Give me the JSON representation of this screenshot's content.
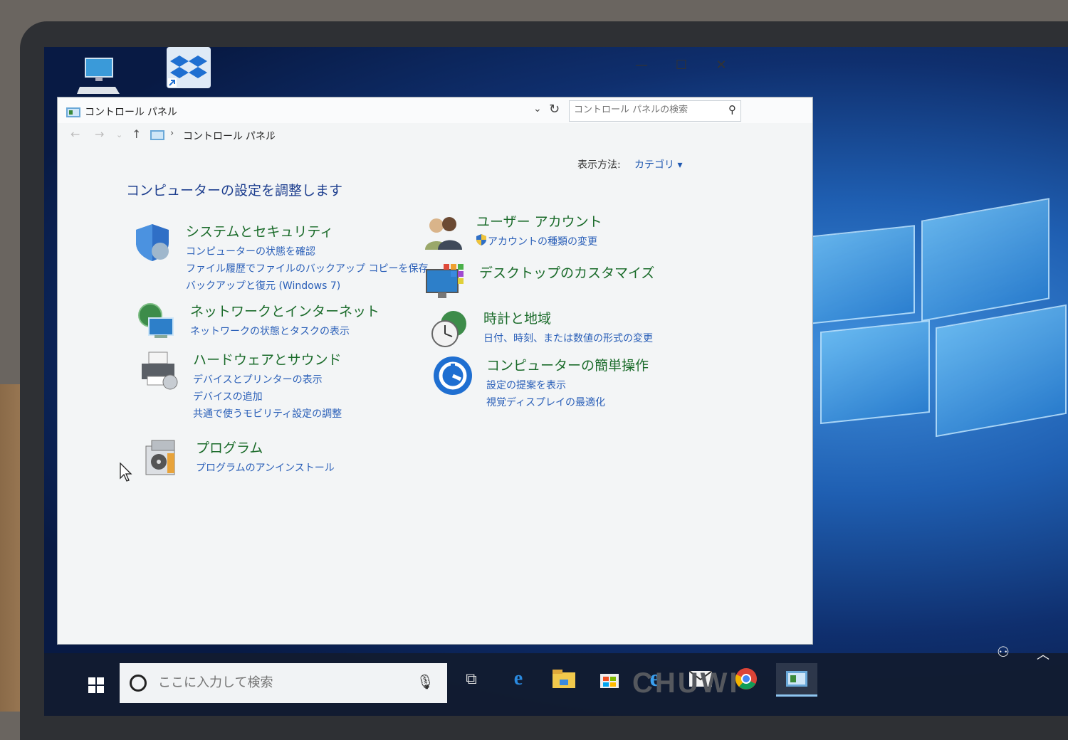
{
  "window": {
    "title": "コントロール パネル",
    "minimize": "—",
    "maximize": "☐",
    "close": "✕",
    "search_placeholder": "コントロール パネルの検索"
  },
  "breadcrumb": {
    "sep": "›",
    "current": "コントロール パネル"
  },
  "view_by": {
    "label": "表示方法:",
    "value": "カテゴリ ▾"
  },
  "heading": "コンピューターの設定を調整します",
  "categories_left": [
    {
      "title": "システムとセキュリティ",
      "icon": "shield-icon",
      "links": [
        "コンピューターの状態を確認",
        "ファイル履歴でファイルのバックアップ コピーを保存",
        "バックアップと復元 (Windows 7)"
      ]
    },
    {
      "title": "ネットワークとインターネット",
      "icon": "network-icon",
      "links": [
        "ネットワークの状態とタスクの表示"
      ]
    },
    {
      "title": "ハードウェアとサウンド",
      "icon": "printer-icon",
      "links": [
        "デバイスとプリンターの表示",
        "デバイスの追加",
        "共通で使うモビリティ設定の調整"
      ]
    },
    {
      "title": "プログラム",
      "icon": "programs-icon",
      "links": [
        "プログラムのアンインストール"
      ]
    }
  ],
  "categories_right": [
    {
      "title": "ユーザー アカウント",
      "icon": "users-icon",
      "links": [
        "アカウントの種類の変更"
      ]
    },
    {
      "title": "デスクトップのカスタマイズ",
      "icon": "desktop-icon",
      "links": []
    },
    {
      "title": "時計と地域",
      "icon": "clock-icon",
      "links": [
        "日付、時刻、または数値の形式の変更"
      ]
    },
    {
      "title": "コンピューターの簡単操作",
      "icon": "ease-of-access-icon",
      "links": [
        "設定の提案を表示",
        "視覚ディスプレイの最適化"
      ]
    }
  ],
  "taskbar": {
    "search_placeholder": "ここに入力して検索",
    "apps": [
      "task-view-icon",
      "edge-icon",
      "file-explorer-icon",
      "store-icon",
      "ie-icon",
      "mail-icon",
      "chrome-icon",
      "control-panel-icon"
    ]
  },
  "brand": "CHUWI"
}
